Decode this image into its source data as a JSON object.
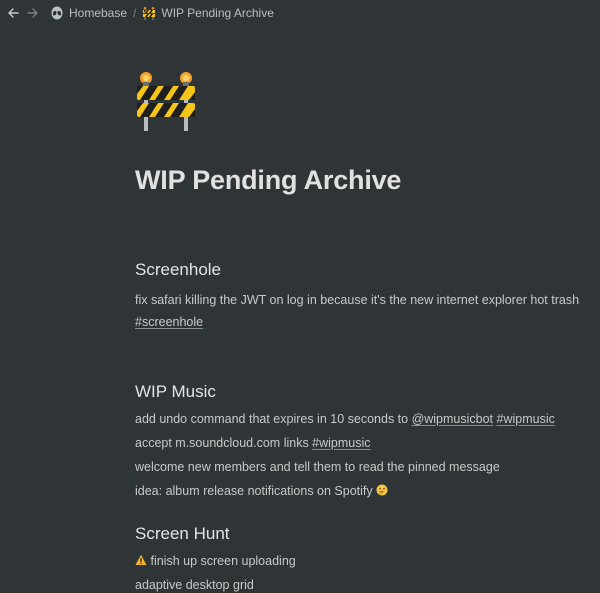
{
  "breadcrumb": {
    "items": [
      {
        "label": "Homebase",
        "icon": "alien-icon"
      },
      {
        "label": "WIP Pending Archive",
        "icon": "construction-barrier-icon"
      }
    ],
    "separator": "/"
  },
  "page": {
    "title": "WIP Pending Archive",
    "icon": "construction-barrier-icon"
  },
  "sections": {
    "screenhole": {
      "heading": "Screenhole",
      "line1": "fix safari killing the JWT on log in because it's the new internet explorer hot trash",
      "line1_tag": "#screenhole"
    },
    "wipmusic": {
      "heading": "WIP Music",
      "line1_text": "add undo command that expires in 10 seconds to ",
      "line1_tag1": "@wipmusicbot",
      "line1_tag2": "#wipmusic",
      "line2_text": "accept m.soundcloud.com links ",
      "line2_tag": "#wipmusic",
      "line3": "welcome new members and tell them to read the pinned message",
      "line4": "idea: album release notifications on Spotify",
      "line4_icon": "thinking-face-icon"
    },
    "screenhunt": {
      "heading": "Screen Hunt",
      "line1_icon": "warning-icon",
      "line1": "finish up screen uploading",
      "line2": "adaptive desktop grid"
    }
  },
  "colors": {
    "background": "#2f3437",
    "text": "#c9c9c9",
    "heading": "#e3e3e3"
  }
}
